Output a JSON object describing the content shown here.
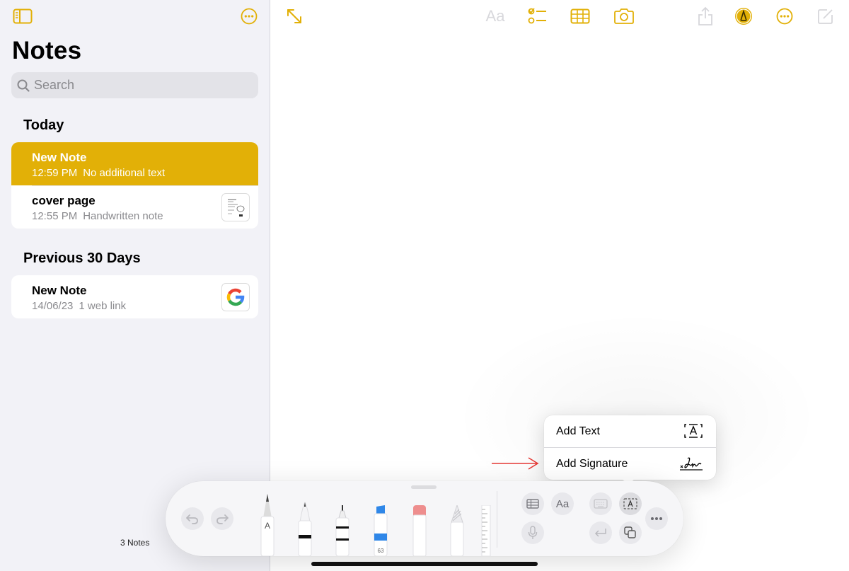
{
  "sidebar": {
    "title": "Notes",
    "search_placeholder": "Search",
    "sections": [
      {
        "header": "Today",
        "notes": [
          {
            "title": "New Note",
            "time": "12:59 PM",
            "preview": "No additional text",
            "selected": true
          },
          {
            "title": "cover page",
            "time": "12:55 PM",
            "preview": "Handwritten note",
            "thumbnail": "handwritten-thumbnail"
          }
        ]
      },
      {
        "header": "Previous 30 Days",
        "notes": [
          {
            "title": "New Note",
            "time": "14/06/23",
            "preview": "1 web link",
            "thumbnail": "google-logo"
          }
        ]
      }
    ],
    "count": "3 Notes"
  },
  "toolbar": {
    "format_label": "Aa",
    "icons": [
      "expand-icon",
      "checklist-icon",
      "table-icon",
      "camera-icon",
      "share-icon",
      "markup-icon",
      "more-icon",
      "compose-icon"
    ]
  },
  "popup": {
    "items": [
      {
        "label": "Add Text",
        "icon": "text-box-icon"
      },
      {
        "label": "Add Signature",
        "icon": "signature-icon"
      }
    ]
  },
  "palette": {
    "tools": [
      "pencil-a",
      "pen",
      "fineliner",
      "highlighter",
      "eraser",
      "crayon",
      "ruler"
    ],
    "highlighter_value": "63",
    "pencil_label": "A",
    "format_label": "Aa"
  },
  "colors": {
    "accent": "#e2b007",
    "selected_row": "#e2b007",
    "sidebar_bg": "#f2f2f7",
    "arrow": "#e53935"
  }
}
